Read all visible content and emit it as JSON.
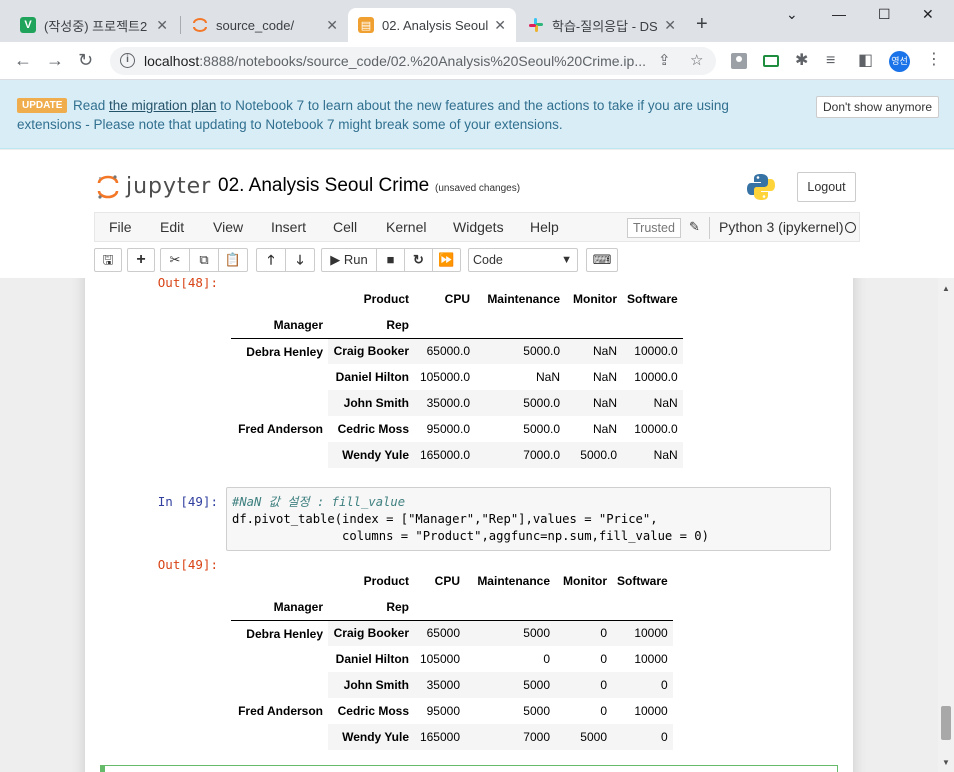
{
  "browser": {
    "tabs": [
      {
        "title": "(작성중) 프로젝트2",
        "favicon_letter": "V",
        "favicon_color": "#20a35a"
      },
      {
        "title": "source_code/",
        "favicon_color": "#f37726"
      },
      {
        "title": "02. Analysis Seoul",
        "favicon_color": "#f37726"
      },
      {
        "title": "학습-질의응답 - DS",
        "favicon_color": "#e01e5a"
      }
    ],
    "url_host": "localhost",
    "url_rest": ":8888/notebooks/source_code/02.%20Analysis%20Seoul%20Crime.ip...",
    "profile_label": "영선"
  },
  "banner": {
    "badge": "UPDATE",
    "pre_link": "Read ",
    "link": "the migration plan",
    "post_link": " to Notebook 7 to learn about the new features and the actions to take if you are using extensions - Please note that updating to Notebook 7 might break some of your extensions.",
    "dismiss": "Don't show anymore"
  },
  "header": {
    "logo_text": "jupyter",
    "notebook_title": "02. Analysis Seoul Crime",
    "save_status": "(unsaved changes)",
    "logout": "Logout"
  },
  "menu": {
    "items": [
      "File",
      "Edit",
      "View",
      "Insert",
      "Cell",
      "Kernel",
      "Widgets",
      "Help"
    ],
    "trusted": "Trusted",
    "kernel": "Python 3 (ipykernel)"
  },
  "toolbar": {
    "run": "Run",
    "cell_type": "Code"
  },
  "cells": {
    "out48_prompt": "Out[48]:",
    "in49_prompt": "In [49]:",
    "out49_prompt": "Out[49]:",
    "in49_code": {
      "comment": "#NaN 값 설정 : fill_value",
      "line2": "df.pivot_table(index = [\"Manager\",\"Rep\"],values = \"Price\",",
      "line3": "               columns = \"Product\",aggfunc=np.sum,fill_value = 0)"
    }
  },
  "table48": {
    "columns": [
      "Product",
      "CPU",
      "Maintenance",
      "Monitor",
      "Software"
    ],
    "index_names": [
      "Manager",
      "Rep"
    ],
    "rows": [
      {
        "manager": "Debra Henley",
        "rep": "Craig Booker",
        "vals": [
          "65000.0",
          "5000.0",
          "NaN",
          "10000.0"
        ]
      },
      {
        "manager": "",
        "rep": "Daniel Hilton",
        "vals": [
          "105000.0",
          "NaN",
          "NaN",
          "10000.0"
        ]
      },
      {
        "manager": "",
        "rep": "John Smith",
        "vals": [
          "35000.0",
          "5000.0",
          "NaN",
          "NaN"
        ]
      },
      {
        "manager": "Fred Anderson",
        "rep": "Cedric Moss",
        "vals": [
          "95000.0",
          "5000.0",
          "NaN",
          "10000.0"
        ]
      },
      {
        "manager": "",
        "rep": "Wendy Yule",
        "vals": [
          "165000.0",
          "7000.0",
          "5000.0",
          "NaN"
        ]
      }
    ]
  },
  "table49": {
    "columns": [
      "Product",
      "CPU",
      "Maintenance",
      "Monitor",
      "Software"
    ],
    "index_names": [
      "Manager",
      "Rep"
    ],
    "rows": [
      {
        "manager": "Debra Henley",
        "rep": "Craig Booker",
        "vals": [
          "65000",
          "5000",
          "0",
          "10000"
        ]
      },
      {
        "manager": "",
        "rep": "Daniel Hilton",
        "vals": [
          "105000",
          "0",
          "0",
          "10000"
        ]
      },
      {
        "manager": "",
        "rep": "John Smith",
        "vals": [
          "35000",
          "5000",
          "0",
          "0"
        ]
      },
      {
        "manager": "Fred Anderson",
        "rep": "Cedric Moss",
        "vals": [
          "95000",
          "5000",
          "0",
          "10000"
        ]
      },
      {
        "manager": "",
        "rep": "Wendy Yule",
        "vals": [
          "165000",
          "7000",
          "5000",
          "0"
        ]
      }
    ]
  }
}
